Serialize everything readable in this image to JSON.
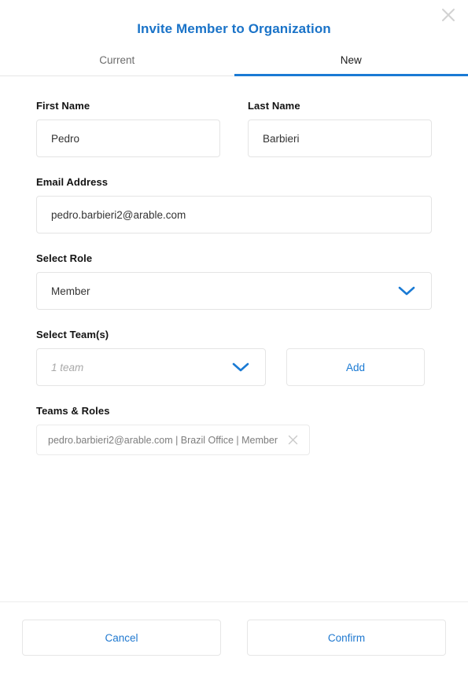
{
  "dialog": {
    "title": "Invite Member to Organization",
    "close_icon": "close-icon"
  },
  "tabs": [
    {
      "label": "Current",
      "active": false
    },
    {
      "label": "New",
      "active": true
    }
  ],
  "form": {
    "first_name": {
      "label": "First Name",
      "value": "Pedro",
      "placeholder": "First Name"
    },
    "last_name": {
      "label": "Last Name",
      "value": "Barbieri",
      "placeholder": "Last Name"
    },
    "email": {
      "label": "Email Address",
      "value": "pedro.barbieri2@arable.com",
      "placeholder": "Email Address"
    },
    "role": {
      "label": "Select Role",
      "value": "Member"
    },
    "teams": {
      "label": "Select Team(s)",
      "value": "1 team",
      "add_label": "Add"
    },
    "teams_roles": {
      "label": "Teams & Roles",
      "chips": [
        {
          "text": "pedro.barbieri2@arable.com | Brazil Office | Member"
        }
      ]
    }
  },
  "footer": {
    "cancel_label": "Cancel",
    "confirm_label": "Confirm"
  },
  "colors": {
    "accent": "#1a7ad4",
    "title": "#1a73c8",
    "border": "#e4e4e4",
    "muted_text": "#7d7d7d"
  }
}
